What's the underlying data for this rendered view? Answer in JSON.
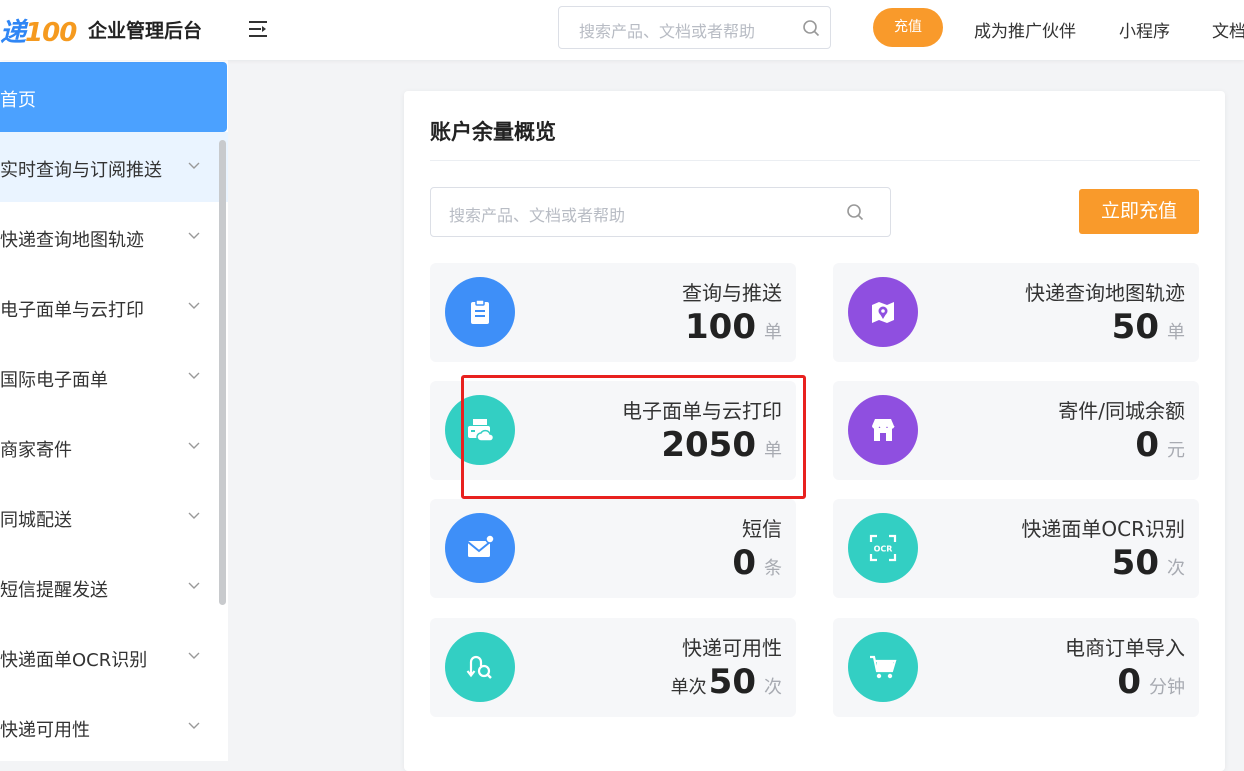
{
  "header": {
    "logo_text": "递",
    "logo_num": "100",
    "title": "企业管理后台",
    "search_placeholder": "搜索产品、文档或者帮助",
    "recharge_label": "充值",
    "links": [
      "成为推广伙伴",
      "小程序",
      "文档"
    ]
  },
  "sidebar": {
    "items": [
      {
        "label": "首页",
        "state": "active"
      },
      {
        "label": "实时查询与订阅推送",
        "state": "open"
      },
      {
        "label": "快递查询地图轨迹",
        "state": ""
      },
      {
        "label": "电子面单与云打印",
        "state": ""
      },
      {
        "label": "国际电子面单",
        "state": ""
      },
      {
        "label": "商家寄件",
        "state": ""
      },
      {
        "label": "同城配送",
        "state": ""
      },
      {
        "label": "短信提醒发送",
        "state": ""
      },
      {
        "label": "快递面单OCR识别",
        "state": ""
      },
      {
        "label": "快递可用性",
        "state": ""
      }
    ]
  },
  "card": {
    "title": "账户余量概览",
    "search_placeholder": "搜索产品、文档或者帮助",
    "charge_label": "立即充值",
    "tiles": [
      {
        "name": "查询与推送",
        "prefix": "",
        "value": "100",
        "unit": "单",
        "icon": "clipboard-icon",
        "color": "#3e8ff8"
      },
      {
        "name": "快递查询地图轨迹",
        "prefix": "",
        "value": "50",
        "unit": "单",
        "icon": "map-pin-icon",
        "color": "#8f4fe0"
      },
      {
        "name": "电子面单与云打印",
        "prefix": "",
        "value": "2050",
        "unit": "单",
        "icon": "cloud-printer-icon",
        "color": "#33cfc3"
      },
      {
        "name": "寄件/同城余额",
        "prefix": "",
        "value": "0",
        "unit": "元",
        "icon": "storefront-icon",
        "color": "#8f4fe0"
      },
      {
        "name": "短信",
        "prefix": "",
        "value": "0",
        "unit": "条",
        "icon": "mail-icon",
        "color": "#3e8ff8"
      },
      {
        "name": "快递面单OCR识别",
        "prefix": "",
        "value": "50",
        "unit": "次",
        "icon": "ocr-scan-icon",
        "color": "#33cfc3"
      },
      {
        "name": "快递可用性",
        "prefix": "单次",
        "value": "50",
        "unit": "次",
        "icon": "route-search-icon",
        "color": "#33cfc3"
      },
      {
        "name": "电商订单导入",
        "prefix": "",
        "value": "0",
        "unit": "分钟",
        "icon": "shopping-cart-icon",
        "color": "#33cfc3"
      }
    ]
  }
}
